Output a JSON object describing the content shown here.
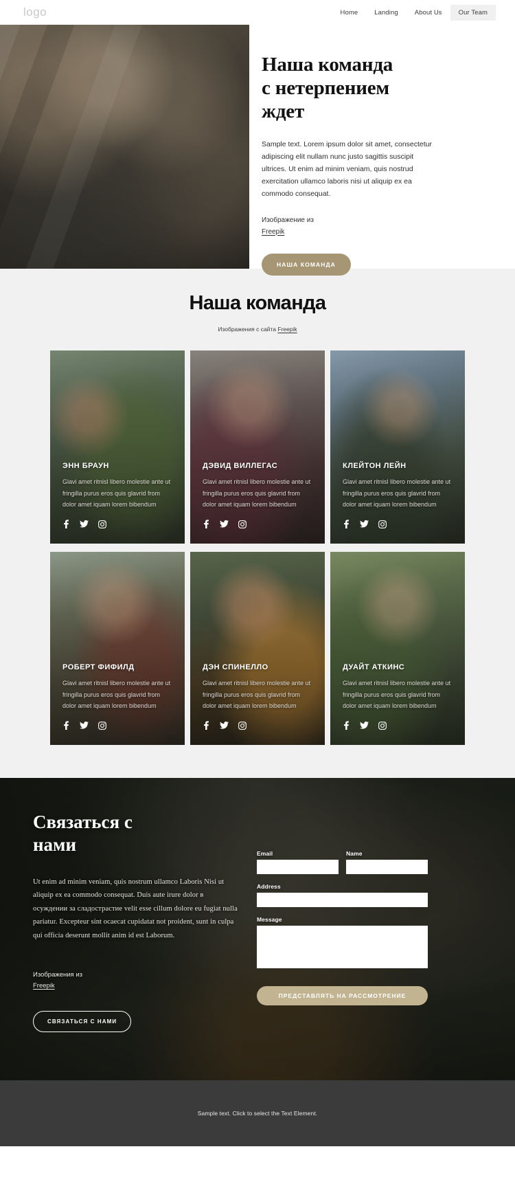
{
  "header": {
    "logo": "logo",
    "nav": [
      {
        "label": "Home",
        "active": false
      },
      {
        "label": "Landing",
        "active": false
      },
      {
        "label": "About Us",
        "active": false
      },
      {
        "label": "Our Team",
        "active": true
      }
    ]
  },
  "hero": {
    "title_line1": "Наша команда",
    "title_line2": "с нетерпением",
    "title_line3": "ждет",
    "paragraph": "Sample text. Lorem ipsum dolor sit amet, consectetur adipiscing elit nullam nunc justo sagittis suscipit ultrices. Ut enim ad minim veniam, quis nostrud exercitation ullamco laboris nisi ut aliquip ex ea commodo consequat.",
    "credit_label": "Изображение из",
    "credit_link": "Freepik",
    "button": "НАША КОМАНДА",
    "button_color": "#a79674"
  },
  "team": {
    "title": "Наша команда",
    "subtitle_prefix": "Изображения с сайта ",
    "subtitle_link": "Freepik",
    "description": "Glavi amet ritnisl libero molestie ante ut fringilla purus eros quis glavrid from dolor amet iquam lorem bibendum",
    "social_icons": [
      "facebook-icon",
      "twitter-icon",
      "instagram-icon"
    ],
    "members": [
      {
        "name": "ЭНН БРАУН"
      },
      {
        "name": "ДЭВИД ВИЛЛЕГАС"
      },
      {
        "name": "КЛЕЙТОН ЛЕЙН"
      },
      {
        "name": "РОБЕРТ ФИФИЛД"
      },
      {
        "name": "ДЭН СПИНЕЛЛО"
      },
      {
        "name": "ДУАЙТ АТКИНС"
      }
    ]
  },
  "contact": {
    "title_line1": "Связаться с",
    "title_line2": "нами",
    "paragraph": "Ut enim ad minim veniam, quis nostrum ullamco Laboris Nisi ut aliquip ex ea commodo consequat. Duis aute irure dolor в осуждении за сладострастие velit esse cillum dolore eu fugiat nulla pariatur. Excepteur sint ocaecat cupidatat not proident, sunt in culpa qui officia deserunt mollit anim id est Laborum.",
    "credit_label": "Изображения из",
    "credit_link": "Freepik",
    "button": "СВЯЗАТЬСЯ С НАМИ",
    "form": {
      "email_label": "Email",
      "email_value": "",
      "name_label": "Name",
      "name_value": "",
      "address_label": "Address",
      "address_value": "",
      "message_label": "Message",
      "message_value": "",
      "submit_label": "ПРЕДСТАВЛЯТЬ НА РАССМОТРЕНИЕ",
      "submit_color": "#c2b391"
    }
  },
  "footer": {
    "text": "Sample text. Click to select the Text Element.",
    "background": "#3b3b3b"
  }
}
